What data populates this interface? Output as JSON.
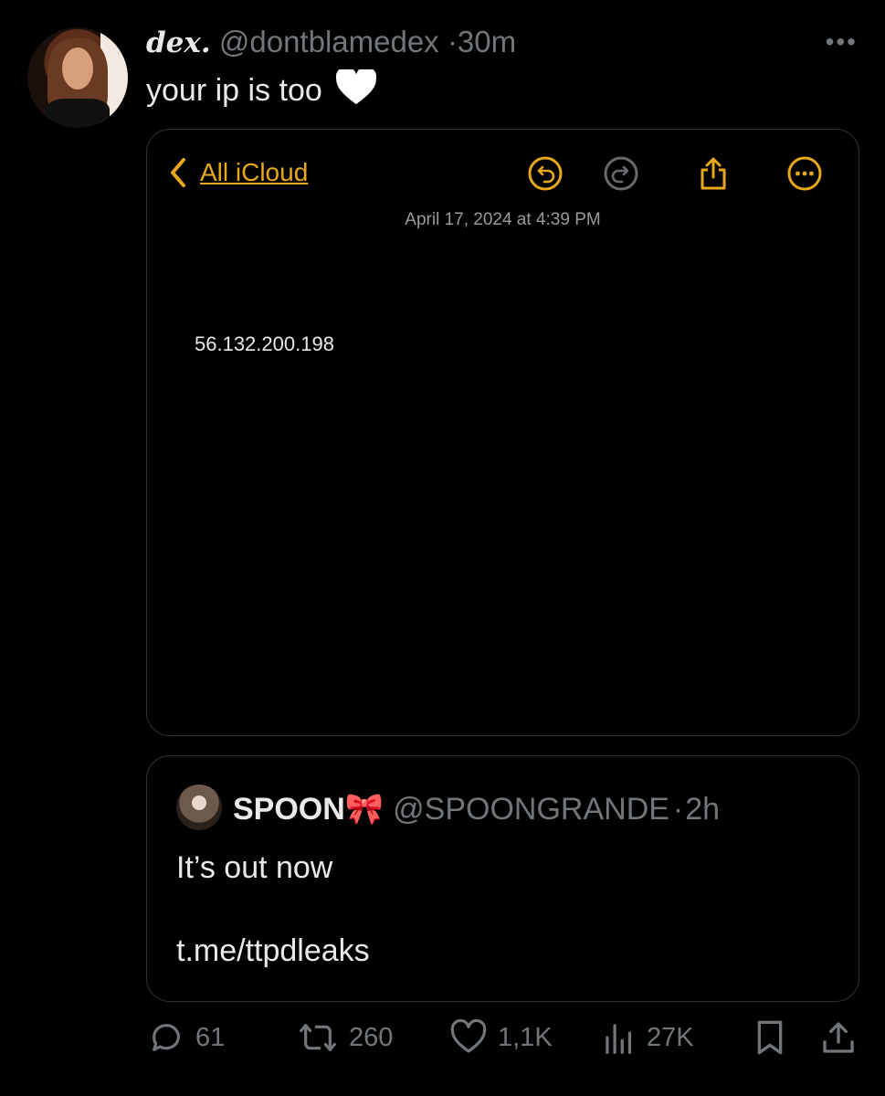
{
  "tweet": {
    "display_name": "dex.",
    "handle": "@dontblamedex",
    "separator": "·",
    "time": "30m",
    "text": "your ip is too",
    "more_label": "•••"
  },
  "media": {
    "back_label": "All iCloud",
    "date": "April 17, 2024 at 4:39 PM",
    "note_text": "56.132.200.198",
    "accent_color": "#e8a81b"
  },
  "quote": {
    "display_name": "SPOON🎀",
    "handle": "@SPOONGRANDE",
    "separator": "·",
    "time": "2h",
    "text": "It’s out now",
    "link": "t.me/ttpdleaks"
  },
  "actions": {
    "replies": "61",
    "retweets": "260",
    "likes": "1,1K",
    "views": "27K"
  }
}
